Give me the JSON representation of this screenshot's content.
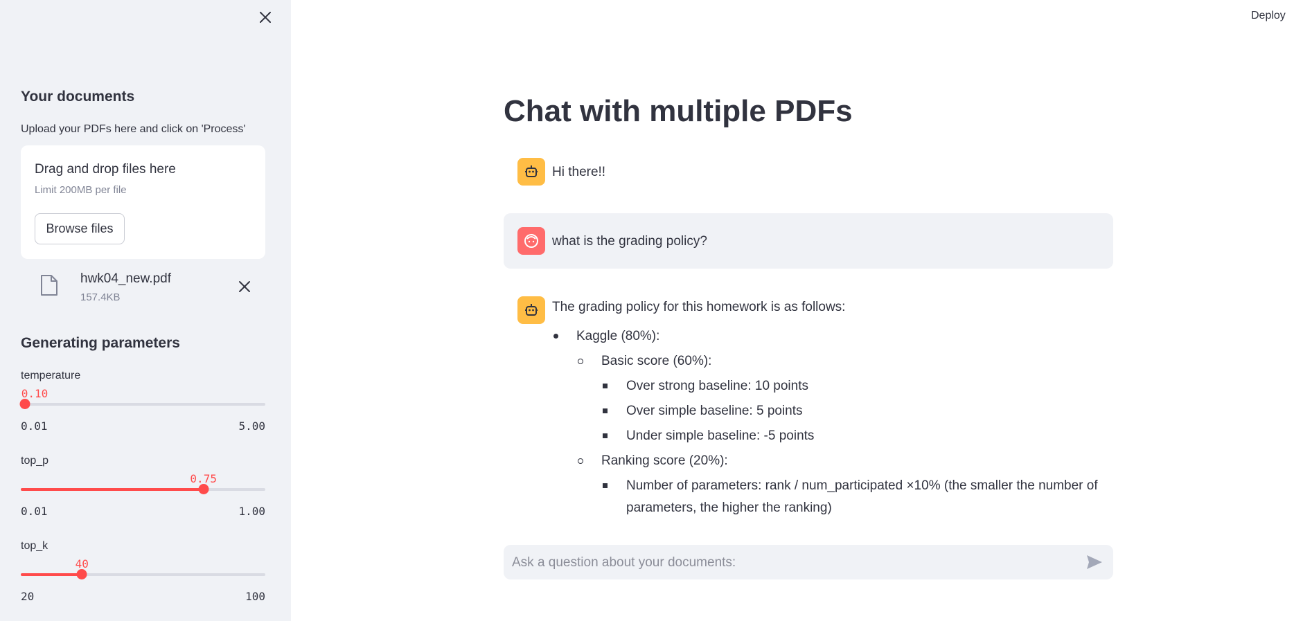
{
  "sidebar": {
    "heading": "Your documents",
    "description": "Upload your PDFs here and click on 'Process'",
    "uploader": {
      "title": "Drag and drop files here",
      "limit": "Limit 200MB per file",
      "browse_label": "Browse files"
    },
    "file": {
      "name": "hwk04_new.pdf",
      "size": "157.4KB"
    },
    "params_heading": "Generating parameters",
    "sliders": [
      {
        "label": "temperature",
        "value": "0.10",
        "min": "0.01",
        "max": "5.00",
        "fraction": 0.018
      },
      {
        "label": "top_p",
        "value": "0.75",
        "min": "0.01",
        "max": "1.00",
        "fraction": 0.747
      },
      {
        "label": "top_k",
        "value": "40",
        "min": "20",
        "max": "100",
        "fraction": 0.25
      }
    ],
    "accent_color": "#ff4b4b"
  },
  "header": {
    "deploy_label": "Deploy"
  },
  "main": {
    "title": "Chat with multiple PDFs",
    "messages": [
      {
        "role": "assistant",
        "text": "Hi there!!"
      },
      {
        "role": "user",
        "text": "what is the grading policy?"
      },
      {
        "role": "assistant",
        "text": "The grading policy for this homework is as follows:",
        "list": {
          "kaggle": "Kaggle (80%):",
          "basic": "Basic score (60%):",
          "strong": "Over strong baseline: 10 points",
          "simple": "Over simple baseline: 5 points",
          "under": "Under simple baseline: -5 points",
          "ranking": "Ranking score (20%):",
          "params_line1": "Number of parameters: rank / num_participated ×10% (the smaller the number of",
          "params_line2": "parameters, the higher the ranking)"
        }
      }
    ],
    "chat_input": {
      "placeholder": "Ask a question about your documents:"
    }
  },
  "icons": {
    "close": "close-icon",
    "file": "file-icon",
    "remove": "close-icon",
    "bot": "robot-icon",
    "user": "face-icon",
    "send": "send-icon"
  }
}
